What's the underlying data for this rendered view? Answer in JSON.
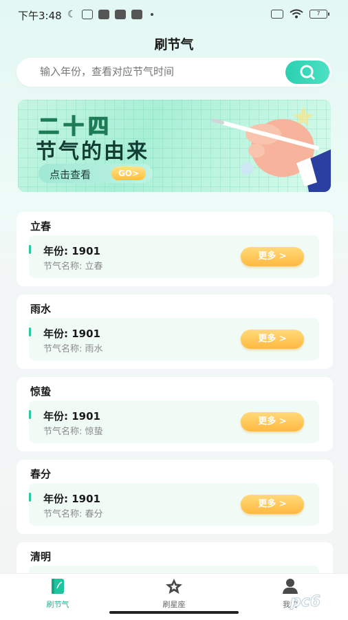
{
  "status": {
    "time": "下午3:48",
    "battery": "7"
  },
  "header": {
    "title": "刷节气"
  },
  "search": {
    "placeholder": "输入年份，查看对应节气时间"
  },
  "banner": {
    "line1": "二十四",
    "line2": "节气的由来",
    "cta": "点击查看",
    "go": "GO>"
  },
  "cards": [
    {
      "title": "立春",
      "year": "年份: 1901",
      "name": "节气名称: 立春",
      "more": "更多 >"
    },
    {
      "title": "雨水",
      "year": "年份: 1901",
      "name": "节气名称: 雨水",
      "more": "更多 >"
    },
    {
      "title": "惊蛰",
      "year": "年份: 1901",
      "name": "节气名称: 惊蛰",
      "more": "更多 >"
    },
    {
      "title": "春分",
      "year": "年份: 1901",
      "name": "节气名称: 春分",
      "more": "更多 >"
    },
    {
      "title": "清明"
    }
  ],
  "tabs": [
    {
      "label": "刷节气",
      "icon": "book-icon",
      "active": true
    },
    {
      "label": "刷星座",
      "icon": "star-icon",
      "active": false
    },
    {
      "label": "我的",
      "icon": "person-icon",
      "active": false
    }
  ],
  "watermark": {
    "text": "pc6"
  },
  "colors": {
    "accent": "#26c9a4",
    "more_button": "#ffba3f"
  }
}
